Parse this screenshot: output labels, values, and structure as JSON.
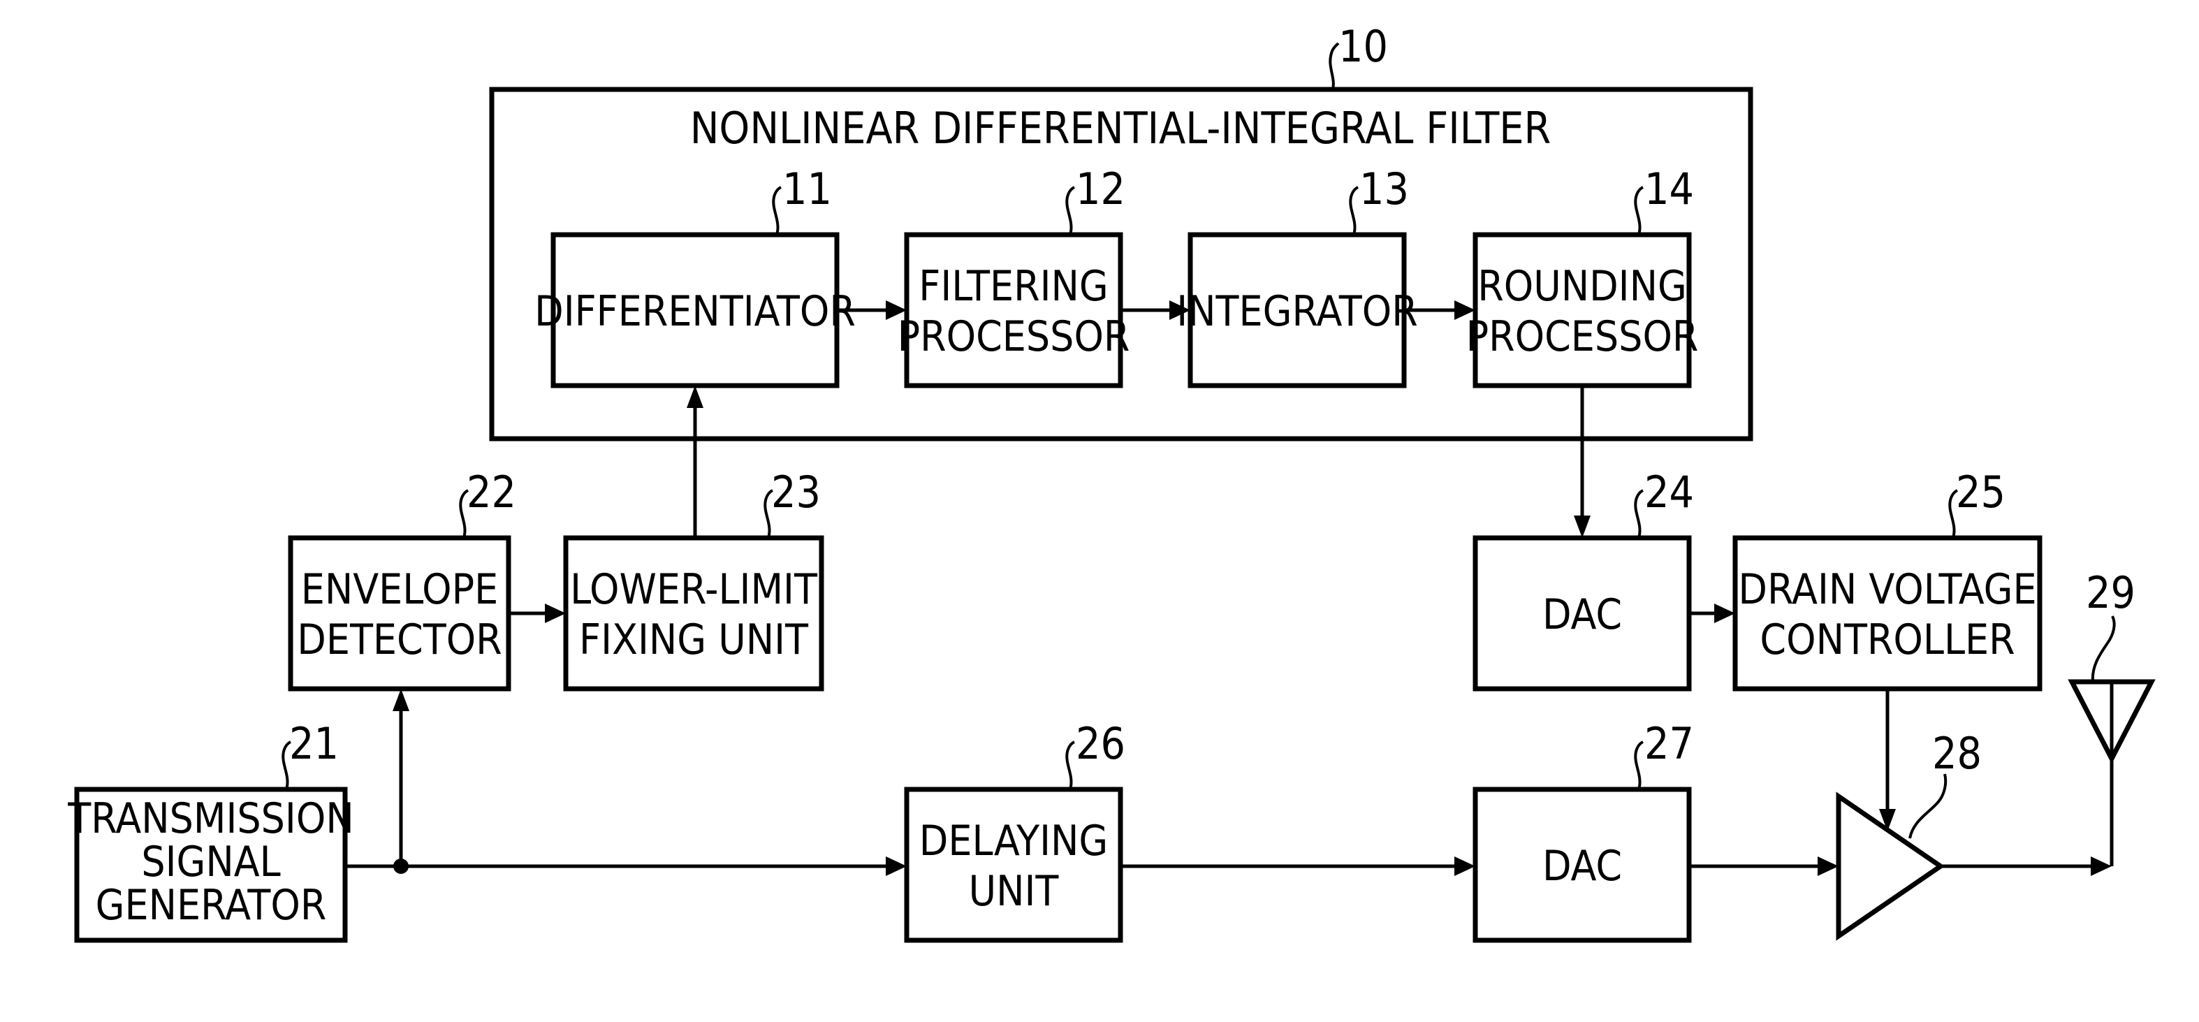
{
  "diagram": {
    "type": "block-diagram",
    "filter": {
      "ref": "10",
      "title": "NONLINEAR DIFFERENTIAL-INTEGRAL FILTER"
    },
    "blocks": {
      "differentiator": {
        "ref": "11",
        "lines": [
          "DIFFERENTIATOR"
        ]
      },
      "filtering_processor": {
        "ref": "12",
        "lines": [
          "FILTERING",
          "PROCESSOR"
        ]
      },
      "integrator": {
        "ref": "13",
        "lines": [
          "INTEGRATOR"
        ]
      },
      "rounding_processor": {
        "ref": "14",
        "lines": [
          "ROUNDING",
          "PROCESSOR"
        ]
      },
      "transmission_signal_generator": {
        "ref": "21",
        "lines": [
          "TRANSMISSION",
          "SIGNAL",
          "GENERATOR"
        ]
      },
      "envelope_detector": {
        "ref": "22",
        "lines": [
          "ENVELOPE",
          "DETECTOR"
        ]
      },
      "lower_limit_fixing_unit": {
        "ref": "23",
        "lines": [
          "LOWER-LIMIT",
          "FIXING UNIT"
        ]
      },
      "dac_24": {
        "ref": "24",
        "lines": [
          "DAC"
        ]
      },
      "drain_voltage_controller": {
        "ref": "25",
        "lines": [
          "DRAIN VOLTAGE",
          "CONTROLLER"
        ]
      },
      "delaying_unit": {
        "ref": "26",
        "lines": [
          "DELAYING",
          "UNIT"
        ]
      },
      "dac_27": {
        "ref": "27",
        "lines": [
          "DAC"
        ]
      },
      "amplifier": {
        "ref": "28"
      },
      "antenna": {
        "ref": "29"
      }
    },
    "connections": [
      [
        "transmission_signal_generator",
        "envelope_detector"
      ],
      [
        "transmission_signal_generator",
        "delaying_unit"
      ],
      [
        "envelope_detector",
        "lower_limit_fixing_unit"
      ],
      [
        "lower_limit_fixing_unit",
        "differentiator"
      ],
      [
        "differentiator",
        "filtering_processor"
      ],
      [
        "filtering_processor",
        "integrator"
      ],
      [
        "integrator",
        "rounding_processor"
      ],
      [
        "rounding_processor",
        "dac_24"
      ],
      [
        "dac_24",
        "drain_voltage_controller"
      ],
      [
        "drain_voltage_controller",
        "amplifier"
      ],
      [
        "delaying_unit",
        "dac_27"
      ],
      [
        "dac_27",
        "amplifier"
      ],
      [
        "amplifier",
        "antenna"
      ]
    ]
  }
}
